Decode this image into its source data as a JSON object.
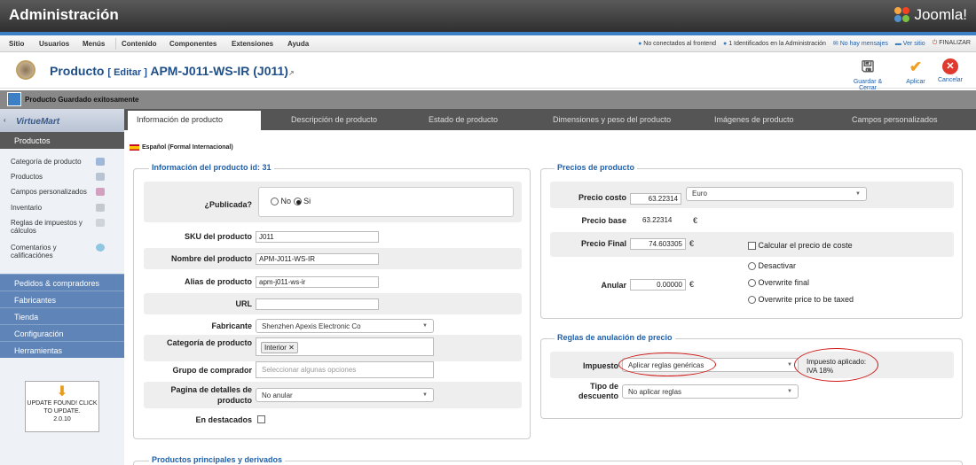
{
  "header": {
    "title": "Administración",
    "logo": "Joomla!"
  },
  "menu": {
    "items": [
      "Sitio",
      "Usuarios",
      "Menús",
      "Contenido",
      "Componentes",
      "Extensiones",
      "Ayuda"
    ],
    "status": {
      "frontend": "No conectados al frontend",
      "admin": "1 Identificados en la Administración",
      "messages": "No hay mensajes",
      "view_site": "Ver sitio",
      "logout": "FINALIZAR"
    }
  },
  "toolbar": {
    "title": "Producto",
    "edit": "[ Editar ]",
    "product": "APM-J011-WS-IR (J011)",
    "save_close": "Guardar & Cerrar",
    "apply": "Aplicar",
    "cancel": "Cancelar"
  },
  "message": "Producto Guardado exitosamente",
  "sidebar": {
    "brand": "VirtueMart",
    "products_header": "Productos",
    "items": [
      "Categoría de producto",
      "Productos",
      "Campos personalizados",
      "Inventario",
      "Reglas de impuestos y cálculos",
      "Comentarios y calificaciónes"
    ],
    "sections": [
      "Pedidos & compradores",
      "Fabricantes",
      "Tienda",
      "Configuración",
      "Herramientas"
    ],
    "update": {
      "line1": "UPDATE FOUND! CLICK",
      "line2": "TO UPDATE.",
      "version": "2.0.10"
    }
  },
  "tabs": [
    "Información de producto",
    "Descripción de producto",
    "Estado de producto",
    "Dimensiones y peso del producto",
    "Imágenes de producto",
    "Campos personalizados"
  ],
  "language": "Español (Formal Internacional)",
  "info": {
    "legend": "Información del producto id: 31",
    "published_label": "¿Publicada?",
    "no": "No",
    "yes": "Si",
    "sku_label": "SKU del producto",
    "sku": "J011",
    "name_label": "Nombre del producto",
    "name": "APM-J011-WS-IR",
    "alias_label": "Alias de producto",
    "alias": "apm-j011-ws-ir",
    "url_label": "URL",
    "url": "",
    "manufacturer_label": "Fabricante",
    "manufacturer": "Shenzhen Apexis Electronic Co",
    "category_label": "Categoría de producto",
    "category_tag": "Interior",
    "group_label": "Grupo de comprador",
    "group_placeholder": "Seleccionar algunas opciones",
    "details_label1": "Pagina de detalles de",
    "details_label2": "producto",
    "details": "No anular",
    "featured_label": "En destacados"
  },
  "prices": {
    "legend": "Precios de producto",
    "cost_label": "Precio costo",
    "cost": "63.22314",
    "currency": "Euro",
    "base_label": "Precio base",
    "base": "63.22314",
    "euro": "€",
    "final_label": "Precio Final",
    "final": "74.603305",
    "calc": "Calcular el precio de coste",
    "override_label": "Anular",
    "override": "0.00000",
    "opt1": "Desactivar",
    "opt2": "Overwrite final",
    "opt3": "Overwrite price to be taxed"
  },
  "rules": {
    "legend": "Reglas de anulación de precio",
    "tax_label": "Impuesto",
    "tax": "Aplicar reglas genéricas",
    "applied1": "Impuesto aplicado:",
    "applied2": "IVA 18%",
    "discount_label1": "Tipo de",
    "discount_label2": "descuento",
    "discount": "No aplicar reglas"
  },
  "related": {
    "legend": "Productos principales y derivados"
  }
}
